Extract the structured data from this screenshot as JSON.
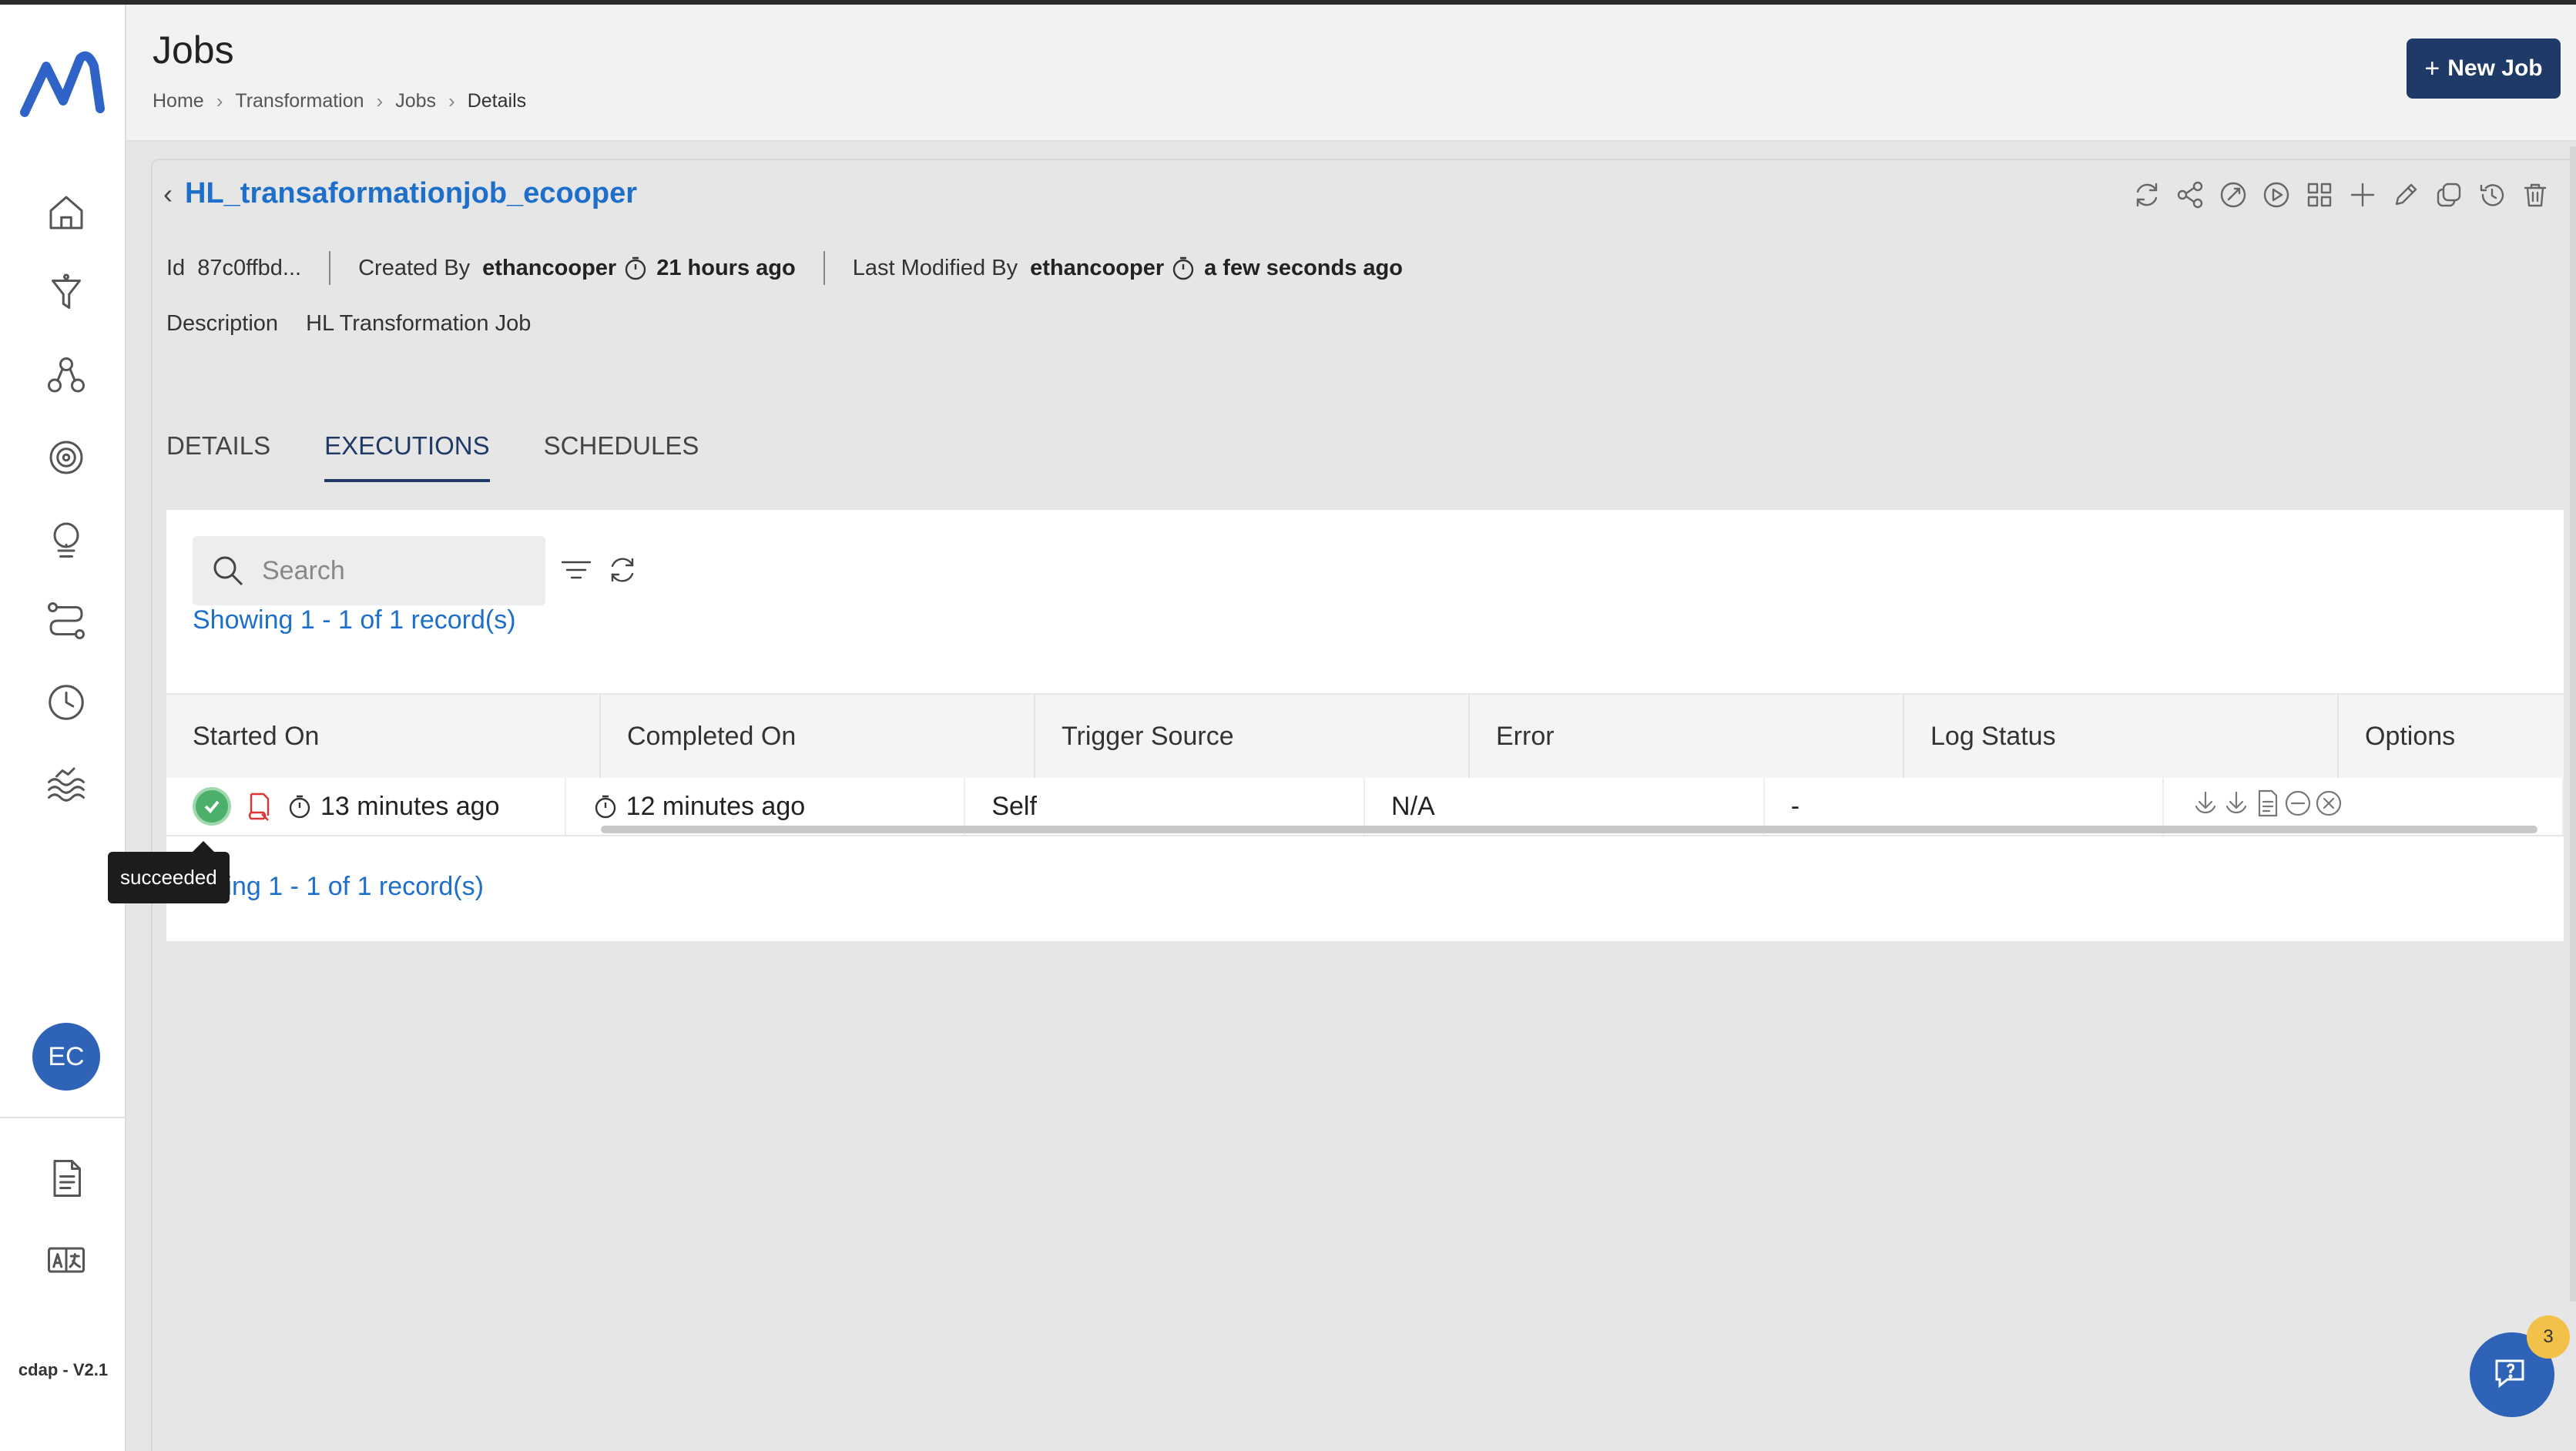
{
  "header": {
    "title": "Jobs",
    "breadcrumb": [
      "Home",
      "Transformation",
      "Jobs",
      "Details"
    ],
    "new_job_label": "New Job"
  },
  "sidebar": {
    "items": [
      "home-icon",
      "funnel-icon",
      "network-icon",
      "target-icon",
      "bulb-icon",
      "route-icon",
      "clock-icon",
      "waves-icon"
    ],
    "avatar_initials": "EC",
    "bottom_items": [
      "document-icon",
      "translate-icon"
    ],
    "version": "cdap - V2.1"
  },
  "job": {
    "name": "HL_transaformationjob_ecooper",
    "id_label": "Id",
    "id_value": "87c0ffbd...",
    "created_by_label": "Created By",
    "created_by": "ethancooper",
    "created_ago": "21 hours ago",
    "modified_by_label": "Last Modified By",
    "modified_by": "ethancooper",
    "modified_ago": "a few seconds ago",
    "description_label": "Description",
    "description": "HL Transformation Job"
  },
  "tabs": [
    {
      "label": "DETAILS",
      "active": false
    },
    {
      "label": "EXECUTIONS",
      "active": true
    },
    {
      "label": "SCHEDULES",
      "active": false
    }
  ],
  "executions": {
    "search_placeholder": "Search",
    "records_top": "Showing 1 - 1 of 1 record(s)",
    "records_bottom": "owing 1 - 1 of 1 record(s)",
    "columns": [
      "Started On",
      "Completed On",
      "Trigger Source",
      "Error",
      "Log Status",
      "Options"
    ],
    "rows": [
      {
        "started_on": "13 minutes ago",
        "completed_on": "12 minutes ago",
        "trigger_source": "Self",
        "error": "N/A",
        "log_status": "-"
      }
    ],
    "status_tooltip": "succeeded"
  },
  "help": {
    "badge_count": "3"
  },
  "colors": {
    "accent": "#1e6fc9",
    "primary": "#1f3a66",
    "success": "#4caf6a",
    "avatar": "#2f63b8"
  }
}
